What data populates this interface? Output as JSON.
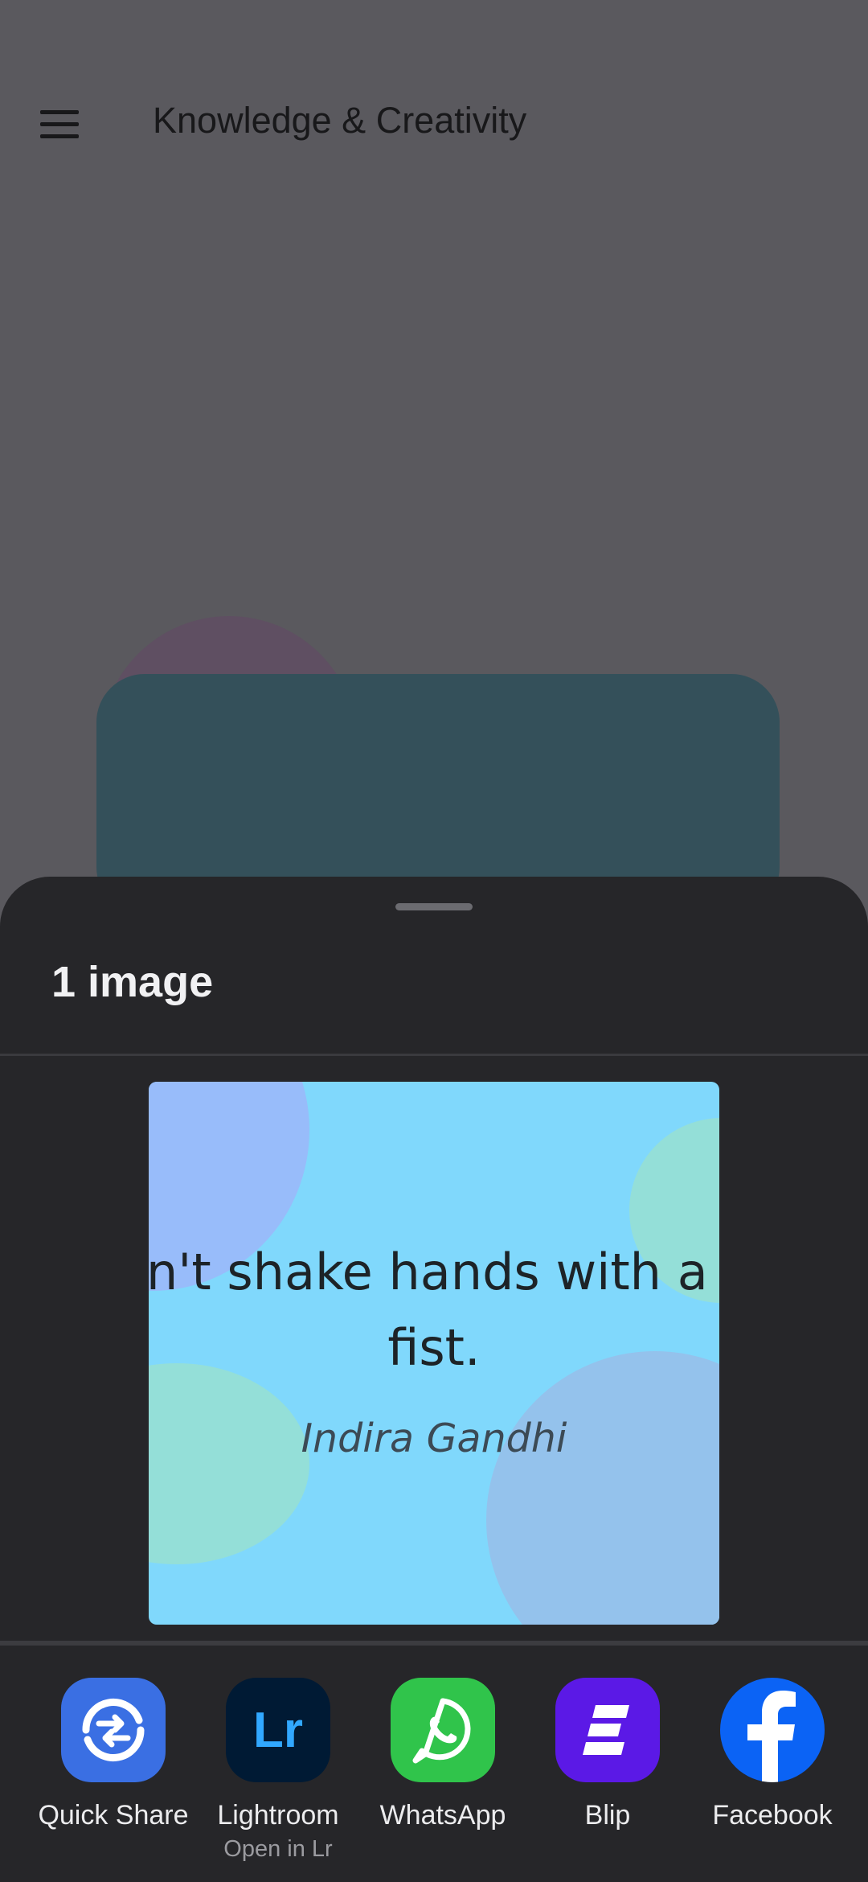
{
  "app": {
    "title": "Knowledge & Creativity"
  },
  "share_sheet": {
    "title": "1 image",
    "preview": {
      "quote_line1": "n't shake hands with a cl",
      "quote_line2": "fist.",
      "author": "Indira Gandhi"
    },
    "targets": [
      {
        "label": "Quick Share",
        "sublabel": "",
        "icon": "quick-share-icon",
        "color": "#3a6fe3"
      },
      {
        "label": "Lightroom",
        "sublabel": "Open in Lr",
        "icon": "lightroom-icon",
        "color": "#001a34"
      },
      {
        "label": "WhatsApp",
        "sublabel": "",
        "icon": "whatsapp-icon",
        "color": "#30c44b"
      },
      {
        "label": "Blip",
        "sublabel": "",
        "icon": "blip-icon",
        "color": "#5b19e6"
      },
      {
        "label": "Facebook",
        "sublabel": "",
        "icon": "facebook-icon",
        "color": "#0b63f5"
      }
    ],
    "lightroom_glyph": "Lr"
  }
}
